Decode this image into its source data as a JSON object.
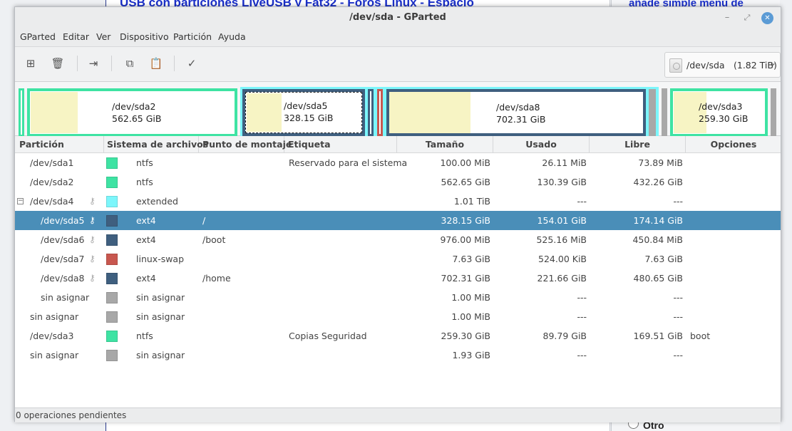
{
  "background_page": {
    "title_link": "USB con particiones LiveUSB y Fat32 - Foros Linux - Espacio",
    "right_text": "añade simple menú de",
    "radio_label": "Otro"
  },
  "window": {
    "title": "/dev/sda - GParted",
    "controls": {
      "minimize": "–",
      "maximize": "⤢",
      "close": "✕"
    }
  },
  "menu": [
    "GParted",
    "Editar",
    "Ver",
    "Dispositivo",
    "Partición",
    "Ayuda"
  ],
  "toolbar": {
    "buttons": [
      {
        "name": "new-partition",
        "icon": "new-partition-icon",
        "glyph": "⊞"
      },
      {
        "name": "delete-partition",
        "icon": "trash-icon",
        "glyph": "🗑"
      },
      {
        "name": "resize-move",
        "icon": "resize-arrow-icon",
        "glyph": "⇥"
      },
      {
        "name": "copy",
        "icon": "copy-icon",
        "glyph": "⧉"
      },
      {
        "name": "paste",
        "icon": "paste-icon",
        "glyph": "📋"
      },
      {
        "name": "apply",
        "icon": "check-icon",
        "glyph": "✓"
      }
    ],
    "device_selector": {
      "device": "/dev/sda",
      "size": "(1.82 TiB)",
      "icon": "disk-icon",
      "chevron": "⌄"
    }
  },
  "diskmap": {
    "labels": {
      "sda2": {
        "name": "/dev/sda2",
        "size": "562.65 GiB"
      },
      "sda5": {
        "name": "/dev/sda5",
        "size": "328.15 GiB"
      },
      "sda8": {
        "name": "/dev/sda8",
        "size": "702.31 GiB"
      },
      "sda3": {
        "name": "/dev/sda3",
        "size": "259.30 GiB"
      }
    }
  },
  "table": {
    "columns": [
      "Partición",
      "Sistema de archivos",
      "Punto de montaje",
      "Etiqueta",
      "Tamaño",
      "Usado",
      "Libre",
      "Opciones"
    ],
    "rows": [
      {
        "partition": "/dev/sda1",
        "fs": "ntfs",
        "color": "#3ee3a3",
        "mount": "",
        "label": "Reservado para el sistema",
        "size": "100.00 MiB",
        "used": "26.11 MiB",
        "free": "73.89 MiB",
        "flags": "",
        "level": 0,
        "key": false,
        "expander": false,
        "selected": false
      },
      {
        "partition": "/dev/sda2",
        "fs": "ntfs",
        "color": "#3ee3a3",
        "mount": "",
        "label": "",
        "size": "562.65 GiB",
        "used": "130.39 GiB",
        "free": "432.26 GiB",
        "flags": "",
        "level": 0,
        "key": false,
        "expander": false,
        "selected": false
      },
      {
        "partition": "/dev/sda4",
        "fs": "extended",
        "color": "#7cf6fb",
        "mount": "",
        "label": "",
        "size": "1.01 TiB",
        "used": "---",
        "free": "---",
        "flags": "",
        "level": 0,
        "key": true,
        "expander": true,
        "selected": false
      },
      {
        "partition": "/dev/sda5",
        "fs": "ext4",
        "color": "#3f5f7f",
        "mount": "/",
        "label": "",
        "size": "328.15 GiB",
        "used": "154.01 GiB",
        "free": "174.14 GiB",
        "flags": "",
        "level": 1,
        "key": true,
        "expander": false,
        "selected": true
      },
      {
        "partition": "/dev/sda6",
        "fs": "ext4",
        "color": "#3f5f7f",
        "mount": "/boot",
        "label": "",
        "size": "976.00 MiB",
        "used": "525.16 MiB",
        "free": "450.84 MiB",
        "flags": "",
        "level": 1,
        "key": true,
        "expander": false,
        "selected": false
      },
      {
        "partition": "/dev/sda7",
        "fs": "linux-swap",
        "color": "#c8574f",
        "mount": "",
        "label": "",
        "size": "7.63 GiB",
        "used": "524.00 KiB",
        "free": "7.63 GiB",
        "flags": "",
        "level": 1,
        "key": true,
        "expander": false,
        "selected": false
      },
      {
        "partition": "/dev/sda8",
        "fs": "ext4",
        "color": "#3f5f7f",
        "mount": "/home",
        "label": "",
        "size": "702.31 GiB",
        "used": "221.66 GiB",
        "free": "480.65 GiB",
        "flags": "",
        "level": 1,
        "key": true,
        "expander": false,
        "selected": false
      },
      {
        "partition": "sin asignar",
        "fs": "sin asignar",
        "color": "#a8a8a8",
        "mount": "",
        "label": "",
        "size": "1.00 MiB",
        "used": "---",
        "free": "---",
        "flags": "",
        "level": 1,
        "key": false,
        "expander": false,
        "selected": false
      },
      {
        "partition": "sin asignar",
        "fs": "sin asignar",
        "color": "#a8a8a8",
        "mount": "",
        "label": "",
        "size": "1.00 MiB",
        "used": "---",
        "free": "---",
        "flags": "",
        "level": 0,
        "key": false,
        "expander": false,
        "selected": false
      },
      {
        "partition": "/dev/sda3",
        "fs": "ntfs",
        "color": "#3ee3a3",
        "mount": "",
        "label": "Copias Seguridad",
        "size": "259.30 GiB",
        "used": "89.79 GiB",
        "free": "169.51 GiB",
        "flags": "boot",
        "level": 0,
        "key": false,
        "expander": false,
        "selected": false
      },
      {
        "partition": "sin asignar",
        "fs": "sin asignar",
        "color": "#a8a8a8",
        "mount": "",
        "label": "",
        "size": "1.93 GiB",
        "used": "---",
        "free": "---",
        "flags": "",
        "level": 0,
        "key": false,
        "expander": false,
        "selected": false
      }
    ]
  },
  "status": {
    "text": "0 operaciones pendientes"
  }
}
